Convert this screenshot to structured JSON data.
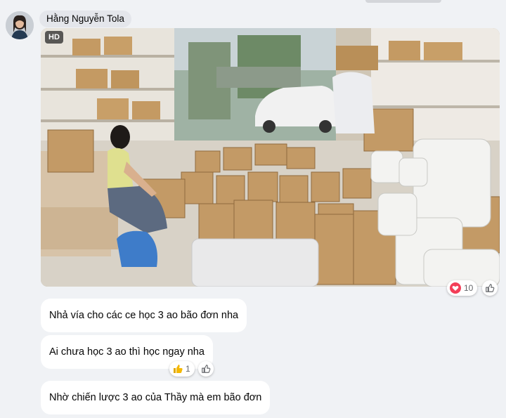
{
  "author": {
    "name": "Hằng Nguyễn Tola"
  },
  "photo": {
    "badge": "HD",
    "reactions": {
      "heart_count": "10"
    }
  },
  "messages": [
    {
      "text": "Nhả vía cho các ce học 3 ao bão đơn nha"
    },
    {
      "text": "Ai chưa học 3 ao thì học ngay nha",
      "reactions": {
        "like_count": "1"
      }
    },
    {
      "text": "Nhờ chiến lược 3 ao của Thầy mà em bão đơn"
    }
  ],
  "colors": {
    "background": "#f0f2f5",
    "bubble": "#ffffff",
    "name_pill": "#e4e6eb",
    "heart": "#e41e3f",
    "like": "#f5b800"
  }
}
